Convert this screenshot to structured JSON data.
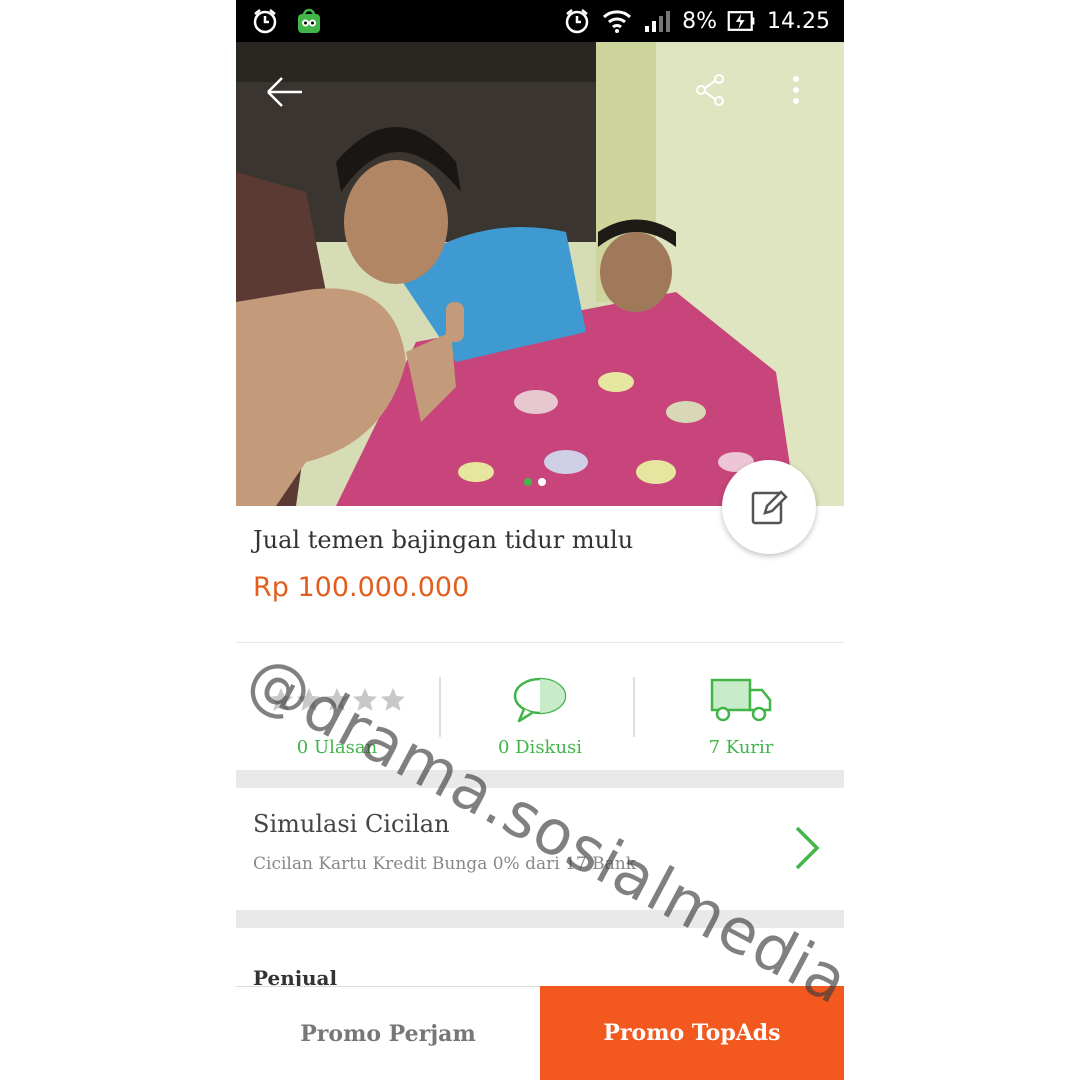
{
  "status_bar": {
    "battery": "8%",
    "time": "14.25",
    "icons": [
      "alarm-icon",
      "tokopedia-app-icon",
      "alarm-icon",
      "wifi-icon",
      "signal-icon",
      "battery-charging-icon"
    ]
  },
  "header": {
    "back_icon": "arrow-left-icon",
    "share_icon": "share-icon",
    "menu_icon": "more-vertical-icon"
  },
  "product": {
    "image_count": 2,
    "active_image": 1,
    "title": "Jual temen bajingan tidur mulu",
    "price": "Rp 100.000.000"
  },
  "stats": {
    "reviews": {
      "label": "0 Ulasan",
      "icon": "star-icon",
      "rating": 0,
      "max_rating": 5
    },
    "discussions": {
      "label": "0 Diskusi",
      "icon": "chat-bubble-icon"
    },
    "couriers": {
      "label": "7 Kurir",
      "icon": "truck-icon"
    }
  },
  "installment": {
    "title": "Simulasi Cicilan",
    "subtitle": "Cicilan Kartu Kredit Bunga 0% dari 17 Bank"
  },
  "seller_section": {
    "title": "Penjual"
  },
  "bottom_bar": {
    "left_label": "Promo Perjam",
    "right_label": "Promo TopAds"
  },
  "watermark": "@drama.sosialmedia",
  "colors": {
    "accent_green": "#42b549",
    "price_orange": "#e25d1e",
    "cta_orange": "#f3581e"
  }
}
